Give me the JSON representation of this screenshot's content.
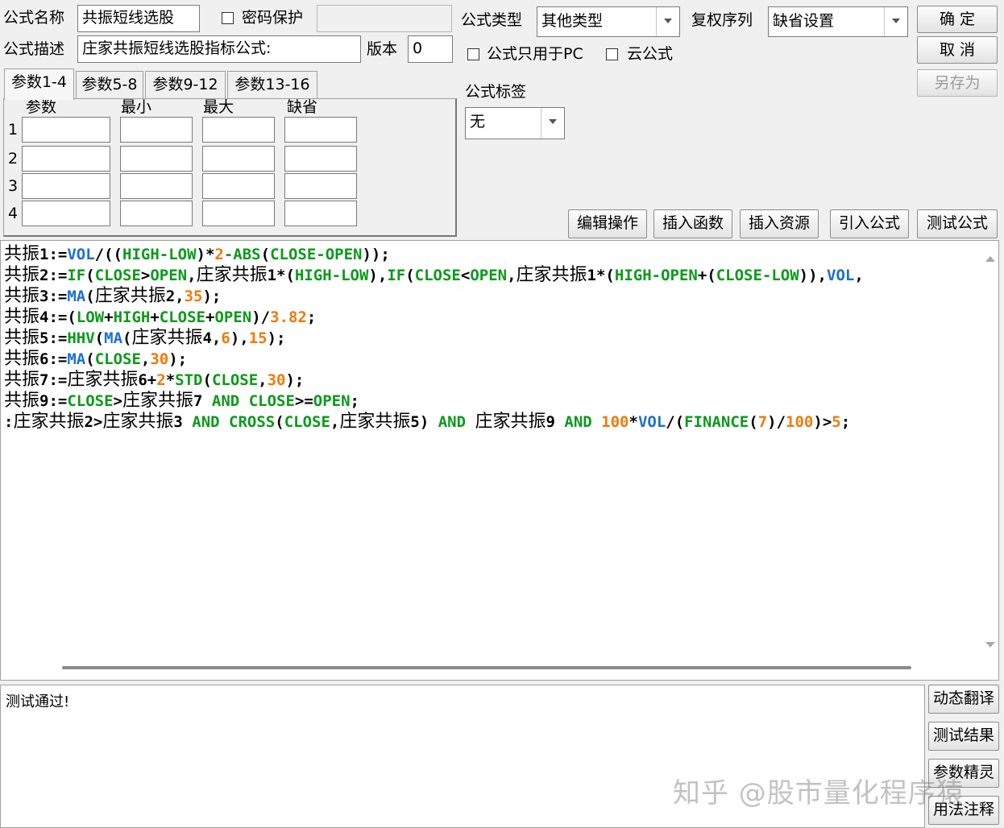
{
  "form": {
    "name_label": "公式名称",
    "name_value": "共振短线选股",
    "password_label": "密码保护",
    "desc_label": "公式描述",
    "desc_value": "庄家共振短线选股指标公式:",
    "version_label": "版本",
    "version_value": "0",
    "type_label": "公式类型",
    "type_value": "其他类型",
    "rights_label": "复权序列",
    "rights_value": "缺省设置",
    "pc_only_label": "公式只用于PC",
    "cloud_label": "云公式",
    "tag_label": "公式标签",
    "tag_value": "无"
  },
  "buttons": {
    "ok": "确  定",
    "cancel": "取  消",
    "save_as": "另存为",
    "edit_ops": "编辑操作",
    "insert_func": "插入函数",
    "insert_res": "插入资源",
    "import_formula": "引入公式",
    "test_formula": "测试公式",
    "dyn_translate": "动态翻译",
    "test_result": "测试结果",
    "param_wizard": "参数精灵",
    "usage_notes": "用法注释"
  },
  "params": {
    "tabs": [
      "参数1-4",
      "参数5-8",
      "参数9-12",
      "参数13-16"
    ],
    "headers": [
      "参数",
      "最小",
      "最大",
      "缺省"
    ],
    "rows": [
      "1",
      "2",
      "3",
      "4"
    ]
  },
  "code": [
    [
      [
        "k",
        "共振"
      ],
      [
        "k",
        "1:="
      ],
      [
        "b",
        "VOL"
      ],
      [
        "k",
        "/(("
      ],
      [
        "g",
        "HIGH-LOW"
      ],
      [
        "k",
        ")*"
      ],
      [
        "o",
        "2"
      ],
      [
        "g",
        "-ABS"
      ],
      [
        "k",
        "("
      ],
      [
        "g",
        "CLOSE-OPEN"
      ],
      [
        "k",
        "));"
      ]
    ],
    [
      [
        "k",
        "共振"
      ],
      [
        "k",
        "2:="
      ],
      [
        "g",
        "IF"
      ],
      [
        "k",
        "("
      ],
      [
        "g",
        "CLOSE"
      ],
      [
        "k",
        ">"
      ],
      [
        "g",
        "OPEN"
      ],
      [
        "k",
        ","
      ],
      [
        "k",
        "庄家共振"
      ],
      [
        "k",
        "1*("
      ],
      [
        "g",
        "HIGH-LOW"
      ],
      [
        "k",
        "),"
      ],
      [
        "g",
        "IF"
      ],
      [
        "k",
        "("
      ],
      [
        "g",
        "CLOSE"
      ],
      [
        "k",
        "<"
      ],
      [
        "g",
        "OPEN"
      ],
      [
        "k",
        ","
      ],
      [
        "k",
        "庄家共振"
      ],
      [
        "k",
        "1*("
      ],
      [
        "g",
        "HIGH-OPEN"
      ],
      [
        "k",
        "+("
      ],
      [
        "g",
        "CLOSE-LOW"
      ],
      [
        "k",
        ")),"
      ],
      [
        "b",
        "VOL"
      ],
      [
        "k",
        ","
      ]
    ],
    [
      [
        "k",
        "共振"
      ],
      [
        "k",
        "3:="
      ],
      [
        "b",
        "MA"
      ],
      [
        "k",
        "("
      ],
      [
        "k",
        "庄家共振"
      ],
      [
        "k",
        "2,"
      ],
      [
        "o",
        "35"
      ],
      [
        "k",
        ");"
      ]
    ],
    [
      [
        "k",
        "共振"
      ],
      [
        "k",
        "4:=("
      ],
      [
        "g",
        "LOW"
      ],
      [
        "k",
        "+"
      ],
      [
        "g",
        "HIGH"
      ],
      [
        "k",
        "+"
      ],
      [
        "g",
        "CLOSE"
      ],
      [
        "k",
        "+"
      ],
      [
        "g",
        "OPEN"
      ],
      [
        "k",
        ")/"
      ],
      [
        "o",
        "3.82"
      ],
      [
        "k",
        ";"
      ]
    ],
    [
      [
        "k",
        "共振"
      ],
      [
        "k",
        "5:="
      ],
      [
        "g",
        "HHV"
      ],
      [
        "k",
        "("
      ],
      [
        "b",
        "MA"
      ],
      [
        "k",
        "("
      ],
      [
        "k",
        "庄家共振"
      ],
      [
        "k",
        "4,"
      ],
      [
        "o",
        "6"
      ],
      [
        "k",
        "),"
      ],
      [
        "o",
        "15"
      ],
      [
        "k",
        ");"
      ]
    ],
    [
      [
        "k",
        "共振"
      ],
      [
        "k",
        "6:="
      ],
      [
        "b",
        "MA"
      ],
      [
        "k",
        "("
      ],
      [
        "g",
        "CLOSE"
      ],
      [
        "k",
        ","
      ],
      [
        "o",
        "30"
      ],
      [
        "k",
        ");"
      ]
    ],
    [
      [
        "k",
        "共振"
      ],
      [
        "k",
        "7:="
      ],
      [
        "k",
        "庄家共振"
      ],
      [
        "k",
        "6+"
      ],
      [
        "o",
        "2"
      ],
      [
        "k",
        "*"
      ],
      [
        "g",
        "STD"
      ],
      [
        "k",
        "("
      ],
      [
        "g",
        "CLOSE"
      ],
      [
        "k",
        ","
      ],
      [
        "o",
        "30"
      ],
      [
        "k",
        ");"
      ]
    ],
    [
      [
        "k",
        "共振"
      ],
      [
        "k",
        "9:="
      ],
      [
        "g",
        "CLOSE"
      ],
      [
        "k",
        ">"
      ],
      [
        "k",
        "庄家共振"
      ],
      [
        "k",
        "7 "
      ],
      [
        "g",
        "AND"
      ],
      [
        "k",
        " "
      ],
      [
        "g",
        "CLOSE"
      ],
      [
        "k",
        ">="
      ],
      [
        "g",
        "OPEN"
      ],
      [
        "k",
        ";"
      ]
    ],
    [
      [
        "k",
        ":"
      ],
      [
        "k",
        "庄家共振"
      ],
      [
        "k",
        "2>"
      ],
      [
        "k",
        "庄家共振"
      ],
      [
        "k",
        "3 "
      ],
      [
        "g",
        "AND"
      ],
      [
        "k",
        " "
      ],
      [
        "g",
        "CROSS"
      ],
      [
        "k",
        "("
      ],
      [
        "g",
        "CLOSE"
      ],
      [
        "k",
        ","
      ],
      [
        "k",
        "庄家共振"
      ],
      [
        "k",
        "5) "
      ],
      [
        "g",
        "AND"
      ],
      [
        "k",
        " "
      ],
      [
        "k",
        "庄家共振"
      ],
      [
        "k",
        "9 "
      ],
      [
        "g",
        "AND"
      ],
      [
        "k",
        " "
      ],
      [
        "o",
        "100"
      ],
      [
        "k",
        "*"
      ],
      [
        "b",
        "VOL"
      ],
      [
        "k",
        "/("
      ],
      [
        "g",
        "FINANCE"
      ],
      [
        "k",
        "("
      ],
      [
        "o",
        "7"
      ],
      [
        "k",
        ")/"
      ],
      [
        "o",
        "100"
      ],
      [
        "k",
        ")>"
      ],
      [
        "o",
        "5"
      ],
      [
        "k",
        ";"
      ]
    ]
  ],
  "output_text": "测试通过!",
  "watermark": "知乎 @股市量化程序猿"
}
